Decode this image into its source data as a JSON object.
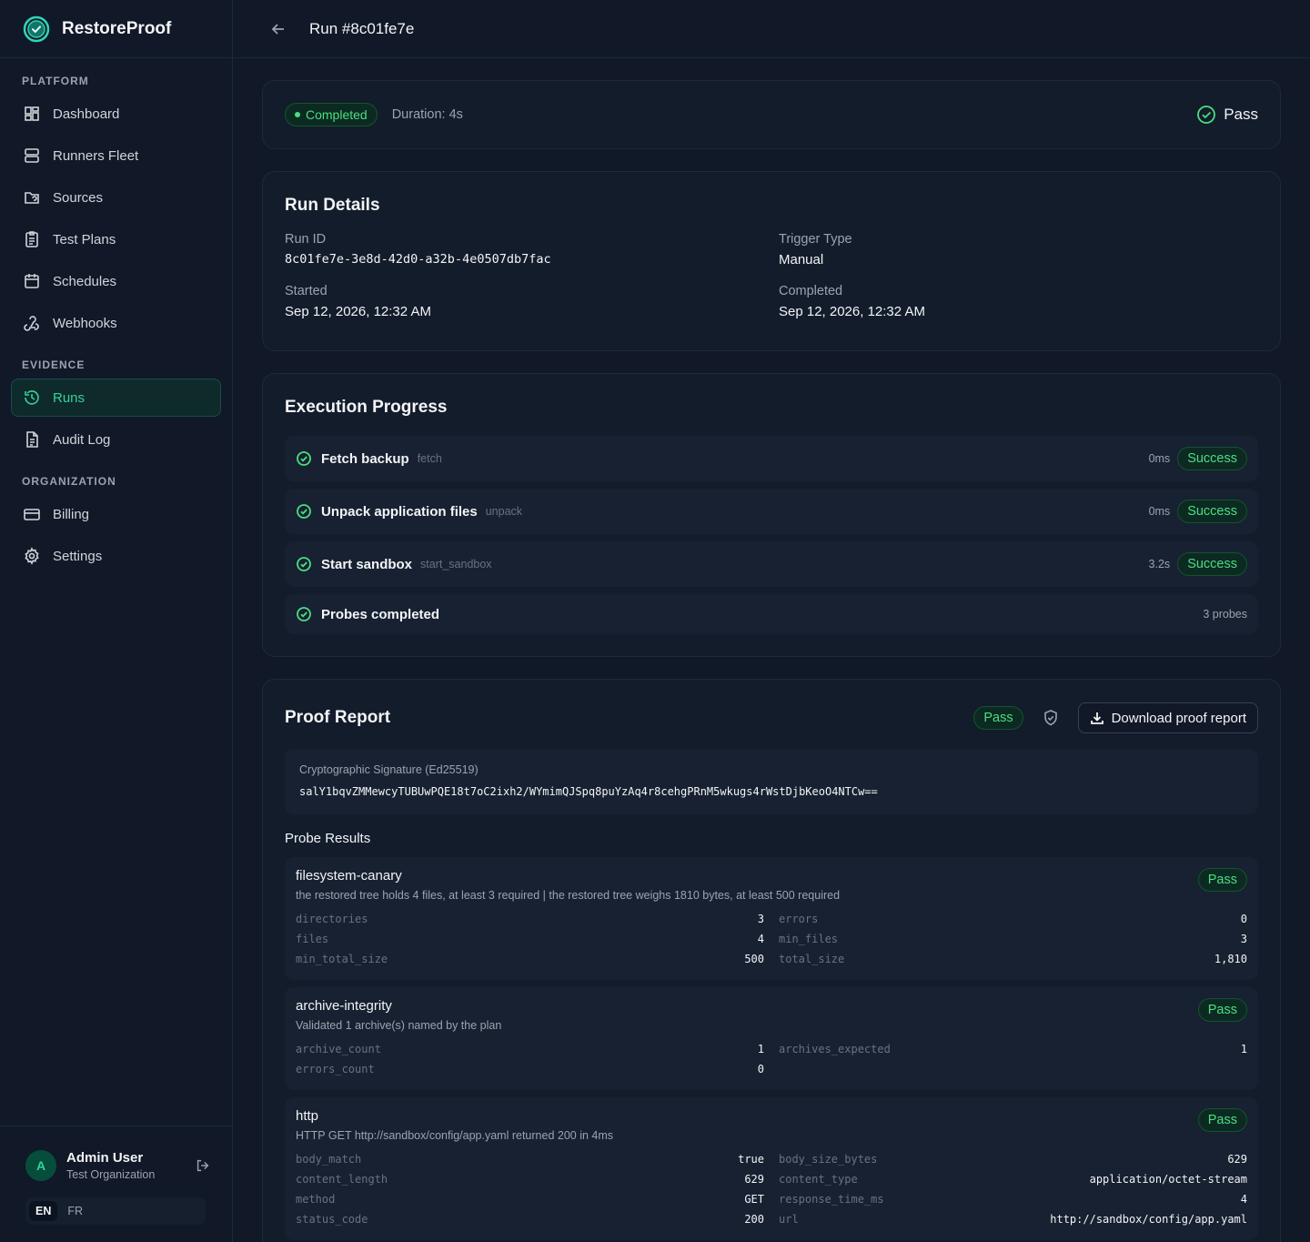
{
  "app": {
    "name": "RestoreProof"
  },
  "sidebar": {
    "sections": [
      {
        "heading": "PLATFORM",
        "items": [
          {
            "label": "Dashboard",
            "icon": "dashboard-icon"
          },
          {
            "label": "Runners Fleet",
            "icon": "server-icon"
          },
          {
            "label": "Sources",
            "icon": "folder-icon"
          },
          {
            "label": "Test Plans",
            "icon": "clipboard-icon"
          },
          {
            "label": "Schedules",
            "icon": "calendar-icon"
          },
          {
            "label": "Webhooks",
            "icon": "webhook-icon"
          }
        ]
      },
      {
        "heading": "EVIDENCE",
        "items": [
          {
            "label": "Runs",
            "icon": "history-icon",
            "active": true
          },
          {
            "label": "Audit Log",
            "icon": "file-text-icon"
          }
        ]
      },
      {
        "heading": "ORGANIZATION",
        "items": [
          {
            "label": "Billing",
            "icon": "credit-card-icon"
          },
          {
            "label": "Settings",
            "icon": "gear-icon"
          }
        ]
      }
    ],
    "user": {
      "initial": "A",
      "name": "Admin User",
      "org": "Test Organization"
    },
    "languages": [
      "EN",
      "FR"
    ],
    "active_language": "EN"
  },
  "header": {
    "title": "Run #8c01fe7e"
  },
  "status": {
    "state": "Completed",
    "duration": "Duration: 4s",
    "result": "Pass"
  },
  "details": {
    "title": "Run Details",
    "fields": [
      {
        "label": "Run ID",
        "value": "8c01fe7e-3e8d-42d0-a32b-4e0507db7fac",
        "mono": true
      },
      {
        "label": "Trigger Type",
        "value": "Manual"
      },
      {
        "label": "Started",
        "value": "Sep 12, 2026, 12:32 AM"
      },
      {
        "label": "Completed",
        "value": "Sep 12, 2026, 12:32 AM"
      }
    ]
  },
  "execution": {
    "title": "Execution Progress",
    "steps": [
      {
        "name": "Fetch backup",
        "key": "fetch",
        "time": "0ms",
        "status": "Success"
      },
      {
        "name": "Unpack application files",
        "key": "unpack",
        "time": "0ms",
        "status": "Success"
      },
      {
        "name": "Start sandbox",
        "key": "start_sandbox",
        "time": "3.2s",
        "status": "Success"
      },
      {
        "name": "Probes completed",
        "key": "",
        "time": "3 probes",
        "status": ""
      }
    ]
  },
  "proof": {
    "title": "Proof Report",
    "result": "Pass",
    "download_label": "Download proof report",
    "signature_label": "Cryptographic Signature (Ed25519)",
    "signature": "salY1bqvZMMewcyTUBUwPQE18t7oC2ixh2/WYmimQJSpq8puYzAq4r8cehgPRnM5wkugs4rWstDjbKeoO4NTCw==",
    "probe_heading": "Probe Results",
    "probes": [
      {
        "name": "filesystem-canary",
        "desc": "the restored tree holds 4 files, at least 3 required | the restored tree weighs 1810 bytes, at least 500 required",
        "status": "Pass",
        "metrics": [
          [
            "directories",
            "3"
          ],
          [
            "errors",
            "0"
          ],
          [
            "files",
            "4"
          ],
          [
            "min_files",
            "3"
          ],
          [
            "min_total_size",
            "500"
          ],
          [
            "total_size",
            "1,810"
          ]
        ]
      },
      {
        "name": "archive-integrity",
        "desc": "Validated 1 archive(s) named by the plan",
        "status": "Pass",
        "metrics": [
          [
            "archive_count",
            "1"
          ],
          [
            "archives_expected",
            "1"
          ],
          [
            "errors_count",
            "0"
          ]
        ]
      },
      {
        "name": "http",
        "desc": "HTTP GET http://sandbox/config/app.yaml returned 200 in 4ms",
        "status": "Pass",
        "metrics": [
          [
            "body_match",
            "true"
          ],
          [
            "body_size_bytes",
            "629"
          ],
          [
            "content_length",
            "629"
          ],
          [
            "content_type",
            "application/octet-stream"
          ],
          [
            "method",
            "GET"
          ],
          [
            "response_time_ms",
            "4"
          ],
          [
            "status_code",
            "200"
          ],
          [
            "url",
            "http://sandbox/config/app.yaml"
          ]
        ]
      }
    ]
  },
  "colors": {
    "accent": "#34d399",
    "success": "#4ade80",
    "background": "#111827",
    "card": "#131c2b"
  }
}
